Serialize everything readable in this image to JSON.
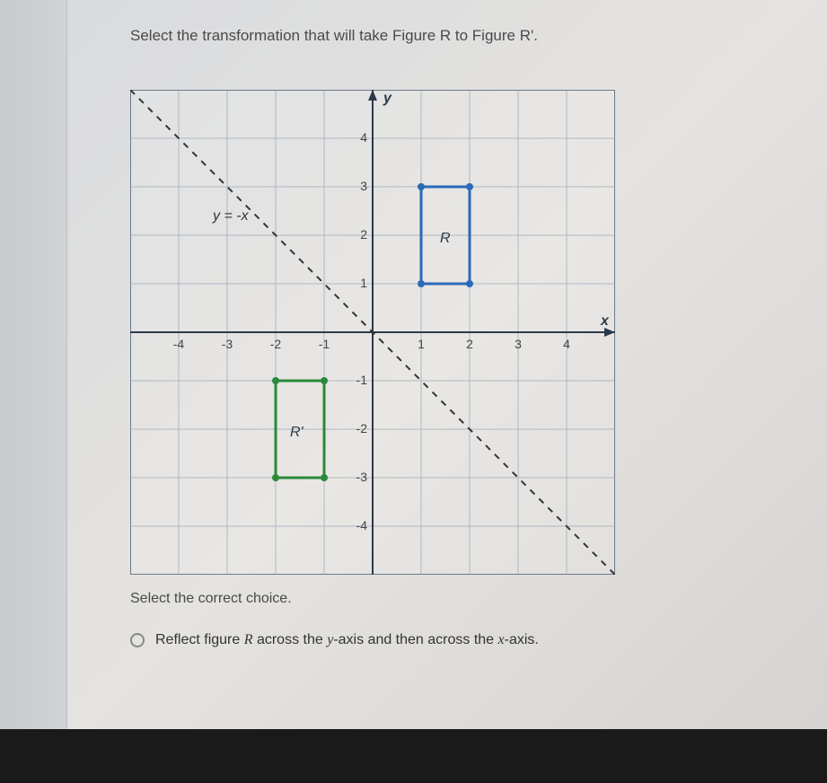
{
  "question": "Select the transformation that will take Figure R to Figure R'.",
  "choice_prompt": "Select the correct choice.",
  "choice1_part1": "Reflect figure ",
  "choice1_var1": "R",
  "choice1_part2": " across the ",
  "choice1_var2": "y",
  "choice1_part3": "-axis and then across the ",
  "choice1_var3": "x",
  "choice1_part4": "-axis.",
  "graph": {
    "line_label": "y = -x",
    "y_label": "y",
    "x_label": "x",
    "figure_r": "R",
    "figure_r_prime": "R'",
    "ticks": {
      "x": [
        "-4",
        "-3",
        "-2",
        "-1",
        "1",
        "2",
        "3",
        "4"
      ],
      "y_pos": [
        "1",
        "2",
        "3",
        "4"
      ],
      "y_neg": [
        "-1",
        "-2",
        "-3",
        "-4"
      ]
    }
  },
  "chart_data": {
    "type": "coordinate-plane",
    "xlim": [
      -5,
      5
    ],
    "ylim": [
      -5,
      5
    ],
    "grid_step": 1,
    "line": {
      "equation": "y = -x",
      "style": "dashed"
    },
    "figures": [
      {
        "name": "R",
        "color": "#3b82d6",
        "vertices": [
          [
            1,
            1
          ],
          [
            2,
            1
          ],
          [
            2,
            3
          ],
          [
            1,
            3
          ]
        ]
      },
      {
        "name": "R'",
        "color": "#2a8a3a",
        "vertices": [
          [
            -2,
            -1
          ],
          [
            -1,
            -1
          ],
          [
            -1,
            -3
          ],
          [
            -2,
            -3
          ]
        ]
      }
    ]
  }
}
